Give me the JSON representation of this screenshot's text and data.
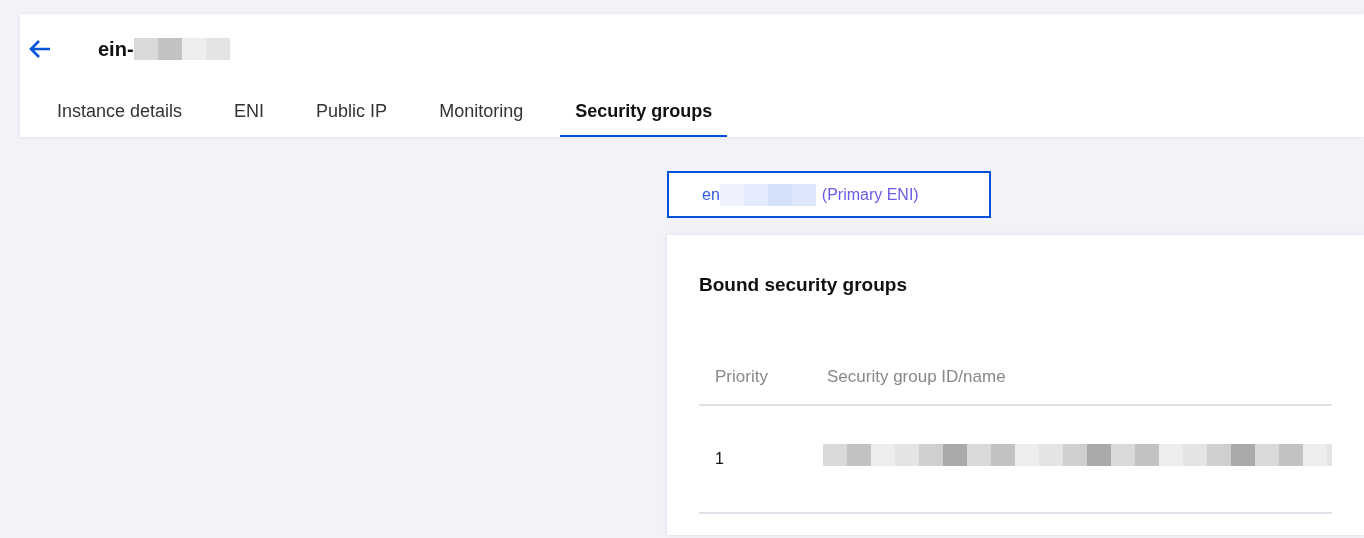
{
  "header": {
    "title": "ein-"
  },
  "tabs": [
    {
      "label": "Instance details",
      "selected": false
    },
    {
      "label": "ENI",
      "selected": false
    },
    {
      "label": "Public IP",
      "selected": false
    },
    {
      "label": "Monitoring",
      "selected": false
    },
    {
      "label": "Security groups",
      "selected": true
    }
  ],
  "eni_selector": {
    "prefix": "en",
    "suffix": "(Primary ENI)"
  },
  "card": {
    "title": "Bound security groups",
    "table": {
      "columns": [
        "Priority",
        "Security group ID/name"
      ],
      "rows": [
        {
          "priority": "1"
        }
      ]
    }
  }
}
